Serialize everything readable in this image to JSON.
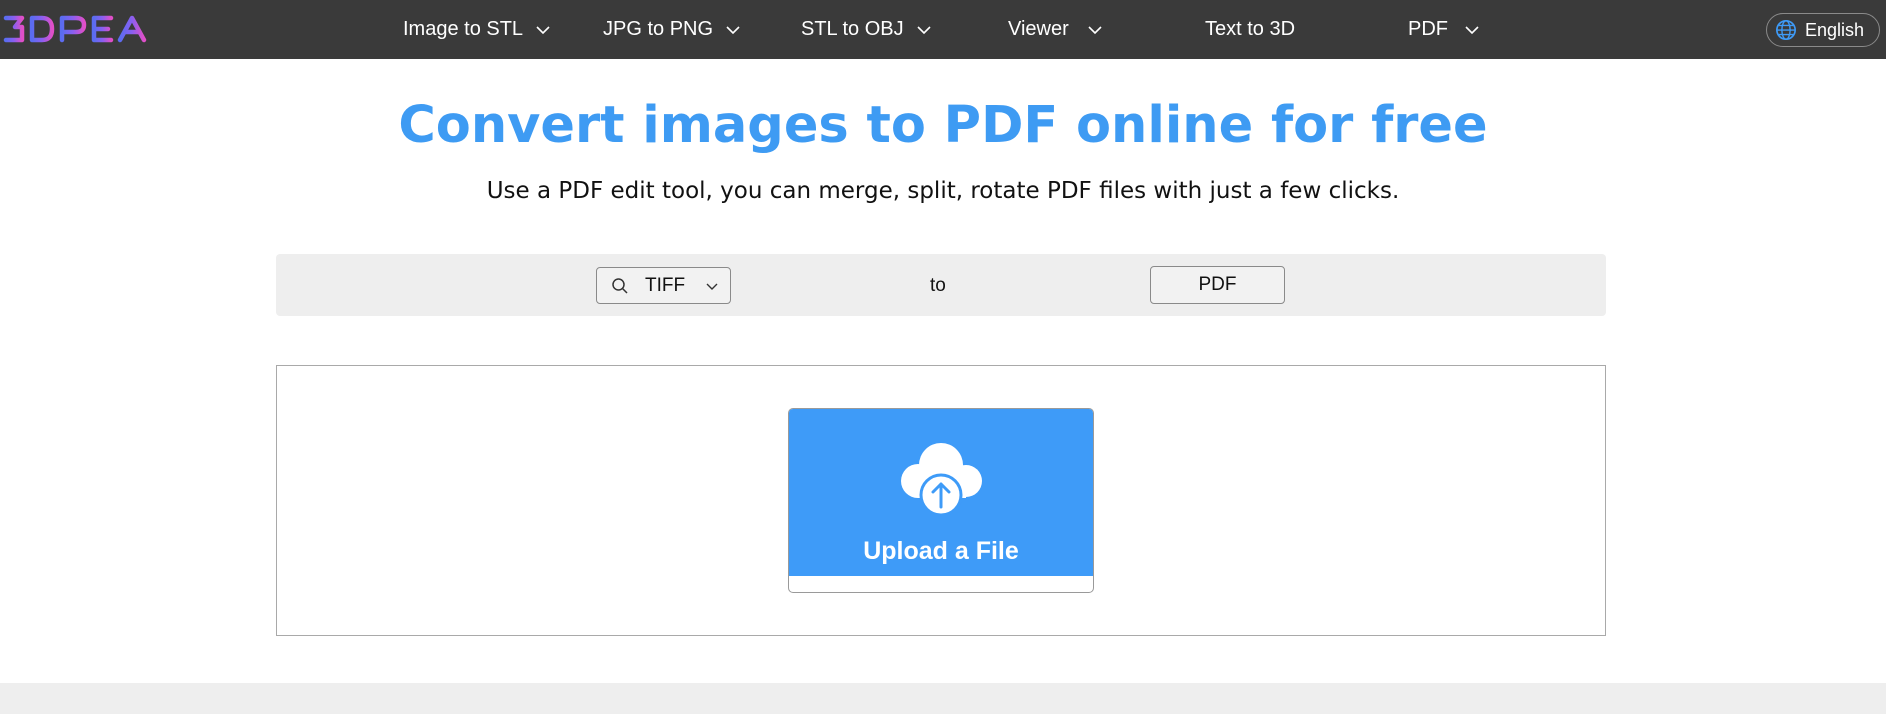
{
  "header": {
    "logo_text": "3DPEA",
    "nav": [
      {
        "label": "Image to STL",
        "has_dropdown": true
      },
      {
        "label": "JPG to PNG",
        "has_dropdown": true
      },
      {
        "label": "STL to OBJ",
        "has_dropdown": true
      },
      {
        "label": "Viewer",
        "has_dropdown": true
      },
      {
        "label": "Text to 3D",
        "has_dropdown": false
      },
      {
        "label": "PDF",
        "has_dropdown": true
      }
    ],
    "language": "English"
  },
  "hero": {
    "title": "Convert images to PDF online for free",
    "subtitle": "Use a PDF edit tool, you can merge, split, rotate PDF files with just a few clicks."
  },
  "converter": {
    "source_format": "TIFF",
    "to_label": "to",
    "target_format": "PDF"
  },
  "upload": {
    "label": "Upload a File"
  },
  "colors": {
    "accent": "#3e9bf8",
    "topbar": "#3a3a3a"
  }
}
